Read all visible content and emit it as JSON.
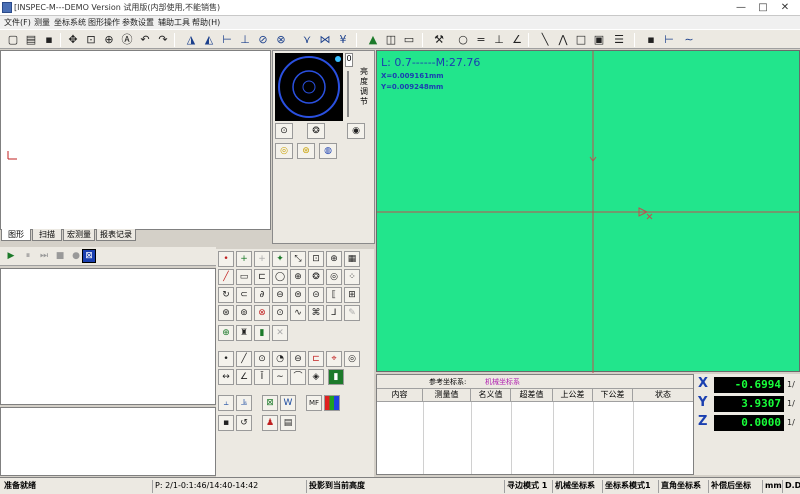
{
  "window": {
    "title": "[INSPEC-M---DEMO Version 试用版(内部使用,不能销售)",
    "minimize": "—",
    "maximize": "□",
    "close": "✕"
  },
  "menu": [
    "文件(F)",
    "测量",
    "坐标系统",
    "图形操作",
    "参数设置",
    "辅助工具",
    "帮助(H)"
  ],
  "left_tabs": [
    "图形",
    "扫描",
    "宏测量",
    "报表记录"
  ],
  "camera_side": {
    "value": "0",
    "label1": "亮",
    "label2": "度",
    "label3": "调",
    "label4": "节"
  },
  "view": {
    "line1": "L: 0.7------M:27.76",
    "line2": "X=0.009161mm",
    "line3": "Y=0.009248mm"
  },
  "result": {
    "ref_label": "参考坐标系:",
    "ref_value": "机械坐标系",
    "columns": [
      "内容",
      "测量值",
      "名义值",
      "超差值",
      "上公差",
      "下公差",
      "状态"
    ]
  },
  "dro": {
    "x_label": "X",
    "x_value": "-0.6994",
    "y_label": "Y",
    "y_value": "3.9307",
    "z_label": "Z",
    "z_value": "0.0000",
    "unit": "1/"
  },
  "status": {
    "ready": "准备就绪",
    "position": "P: 2/1-0:1:46/14:40-14:42",
    "projection": "投影到当前高度",
    "mode": "寻边模式 1",
    "coord": "机械坐标系",
    "coord_mode": "坐标系模式1",
    "angle": "直角坐标系",
    "comp": "补偿后坐标",
    "unit": "mm",
    "dd": "D.D"
  },
  "colors": {
    "view_bg": "#22e58c",
    "crosshair": "#c05050",
    "readout_text": "#1a3fb0",
    "dro_text": "#18ff3a"
  }
}
